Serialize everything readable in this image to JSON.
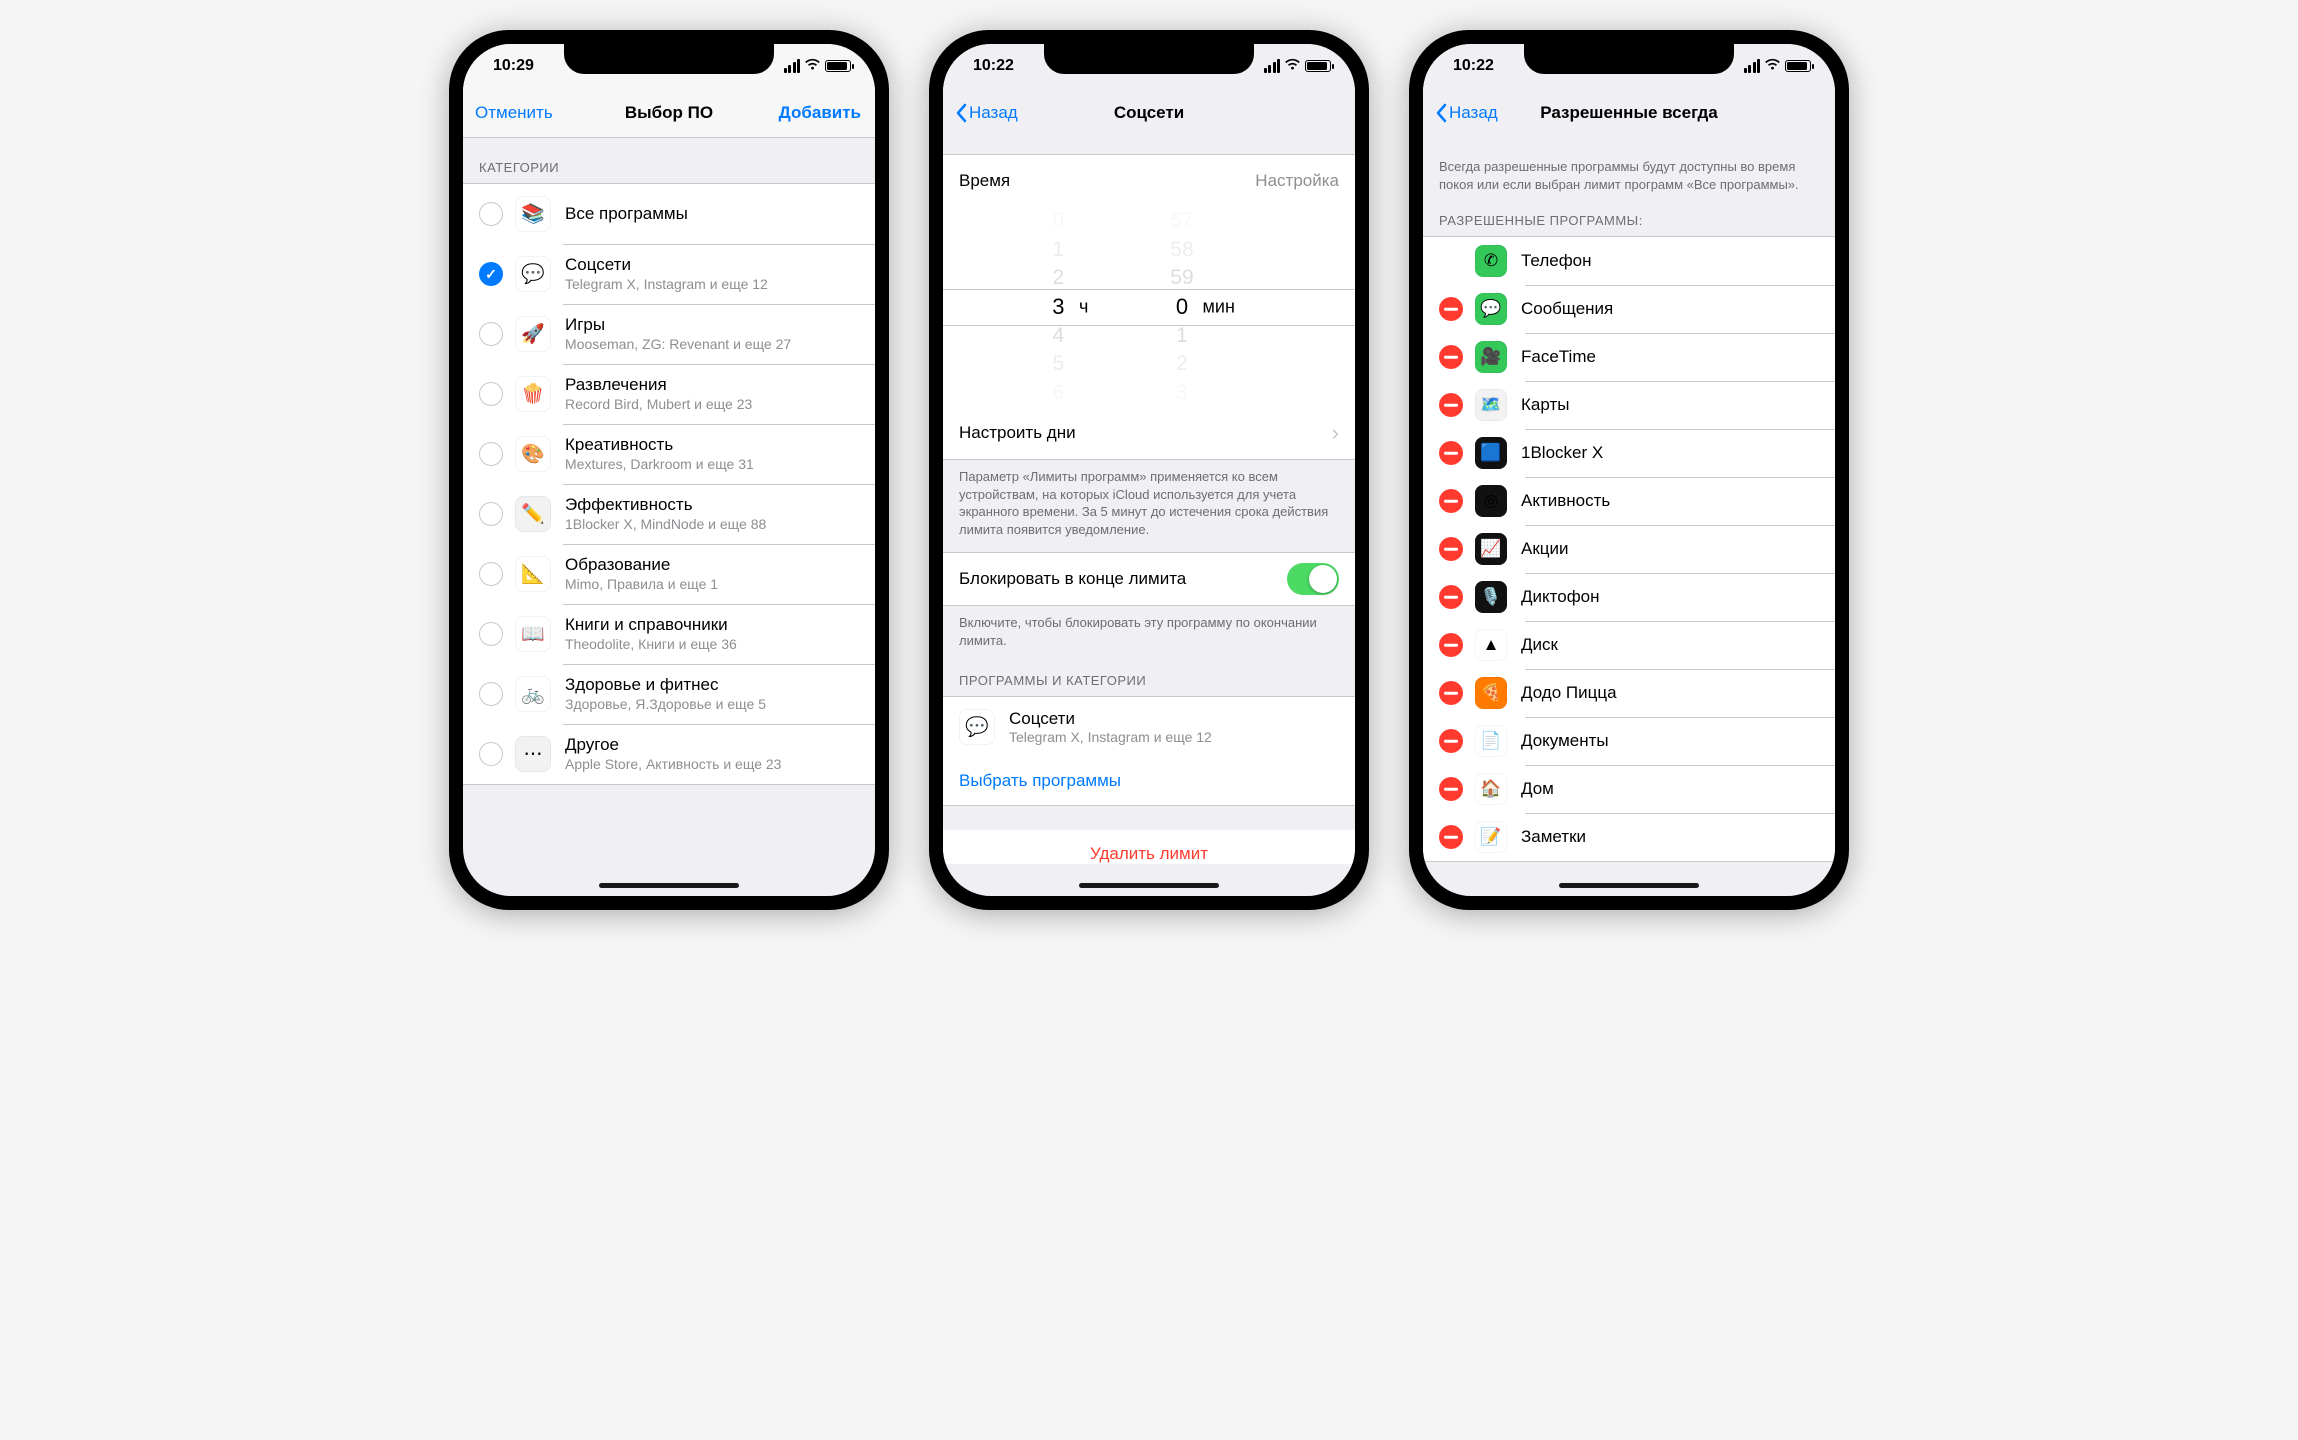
{
  "screen1": {
    "time": "10:29",
    "nav": {
      "cancel": "Отменить",
      "title": "Выбор ПО",
      "add": "Добавить"
    },
    "header": "КАТЕГОРИИ",
    "categories": [
      {
        "icon": "📚",
        "iconbg": "#fff",
        "title": "Все программы",
        "sub": "",
        "checked": false,
        "name": "all-apps"
      },
      {
        "icon": "💬",
        "iconbg": "#fff",
        "title": "Соцсети",
        "sub": "Telegram X, Instagram и еще 12",
        "checked": true,
        "name": "social"
      },
      {
        "icon": "🚀",
        "iconbg": "#fff",
        "title": "Игры",
        "sub": "Mooseman, ZG: Revenant и еще 27",
        "checked": false,
        "name": "games"
      },
      {
        "icon": "🍿",
        "iconbg": "#fff",
        "title": "Развлечения",
        "sub": "Record Bird, Mubert и еще 23",
        "checked": false,
        "name": "entertainment"
      },
      {
        "icon": "🎨",
        "iconbg": "#fff",
        "title": "Креативность",
        "sub": "Mextures, Darkroom и еще 31",
        "checked": false,
        "name": "creativity"
      },
      {
        "icon": "✏️",
        "iconbg": "#f2f2f2",
        "title": "Эффективность",
        "sub": "1Blocker X, MindNode и еще 88",
        "checked": false,
        "name": "productivity"
      },
      {
        "icon": "📐",
        "iconbg": "#fff",
        "title": "Образование",
        "sub": "Mimo, Правила и еще 1",
        "checked": false,
        "name": "education"
      },
      {
        "icon": "📖",
        "iconbg": "#fff",
        "title": "Книги и справочники",
        "sub": "Theodolite, Книги и еще 36",
        "checked": false,
        "name": "books"
      },
      {
        "icon": "🚲",
        "iconbg": "#fff",
        "title": "Здоровье и фитнес",
        "sub": "Здоровье, Я.Здоровье и еще 5",
        "checked": false,
        "name": "health"
      },
      {
        "icon": "⋯",
        "iconbg": "#f2f2f2",
        "title": "Другое",
        "sub": "Apple Store, Активность и еще 23",
        "checked": false,
        "name": "other"
      }
    ]
  },
  "screen2": {
    "time": "10:22",
    "nav": {
      "back": "Назад",
      "title": "Соцсети"
    },
    "time_row": {
      "label": "Время",
      "value": "Настройка"
    },
    "picker": {
      "hours": "3",
      "minutes": "0",
      "hunit": "ч",
      "munit": "мин"
    },
    "customize": "Настроить дни",
    "footer1": "Параметр «Лимиты программ» применяется ко всем устройствам, на которых iCloud используется для учета экранного времени. За 5 минут до истечения срока действия лимита появится уведомление.",
    "block_label": "Блокировать в конце лимита",
    "footer2": "Включите, чтобы блокировать эту программу по окончании лимита.",
    "apps_header": "ПРОГРАММЫ И КАТЕГОРИИ",
    "app_item": {
      "title": "Соцсети",
      "sub": "Telegram X, Instagram и еще 12"
    },
    "choose": "Выбрать программы",
    "delete": "Удалить лимит"
  },
  "screen3": {
    "time": "10:22",
    "nav": {
      "back": "Назад",
      "title": "Разрешенные всегда"
    },
    "desc": "Всегда разрешенные программы будут доступны во время покоя или если выбран лимит программ «Все программы».",
    "header": "РАЗРЕШЕННЫЕ ПРОГРАММЫ:",
    "apps": [
      {
        "label": "Телефон",
        "bg": "#34c759",
        "glyph": "✆",
        "removable": false,
        "name": "phone"
      },
      {
        "label": "Сообщения",
        "bg": "#34c759",
        "glyph": "💬",
        "removable": true,
        "name": "messages"
      },
      {
        "label": "FaceTime",
        "bg": "#34c759",
        "glyph": "🎥",
        "removable": true,
        "name": "facetime"
      },
      {
        "label": "Карты",
        "bg": "#f2f2f2",
        "glyph": "🗺️",
        "removable": true,
        "name": "maps"
      },
      {
        "label": "1Blocker X",
        "bg": "#111",
        "glyph": "🟦",
        "removable": true,
        "name": "1blocker"
      },
      {
        "label": "Активность",
        "bg": "#111",
        "glyph": "◎",
        "removable": true,
        "name": "activity"
      },
      {
        "label": "Акции",
        "bg": "#111",
        "glyph": "📈",
        "removable": true,
        "name": "stocks"
      },
      {
        "label": "Диктофон",
        "bg": "#111",
        "glyph": "🎙️",
        "removable": true,
        "name": "voice-memos"
      },
      {
        "label": "Диск",
        "bg": "#fff",
        "glyph": "▲",
        "removable": true,
        "name": "drive"
      },
      {
        "label": "Додо Пицца",
        "bg": "#ff7a00",
        "glyph": "🍕",
        "removable": true,
        "name": "dodo"
      },
      {
        "label": "Документы",
        "bg": "#fff",
        "glyph": "📄",
        "removable": true,
        "name": "docs"
      },
      {
        "label": "Дом",
        "bg": "#fff",
        "glyph": "🏠",
        "removable": true,
        "name": "home"
      },
      {
        "label": "Заметки",
        "bg": "#fff",
        "glyph": "📝",
        "removable": true,
        "name": "notes"
      }
    ]
  }
}
